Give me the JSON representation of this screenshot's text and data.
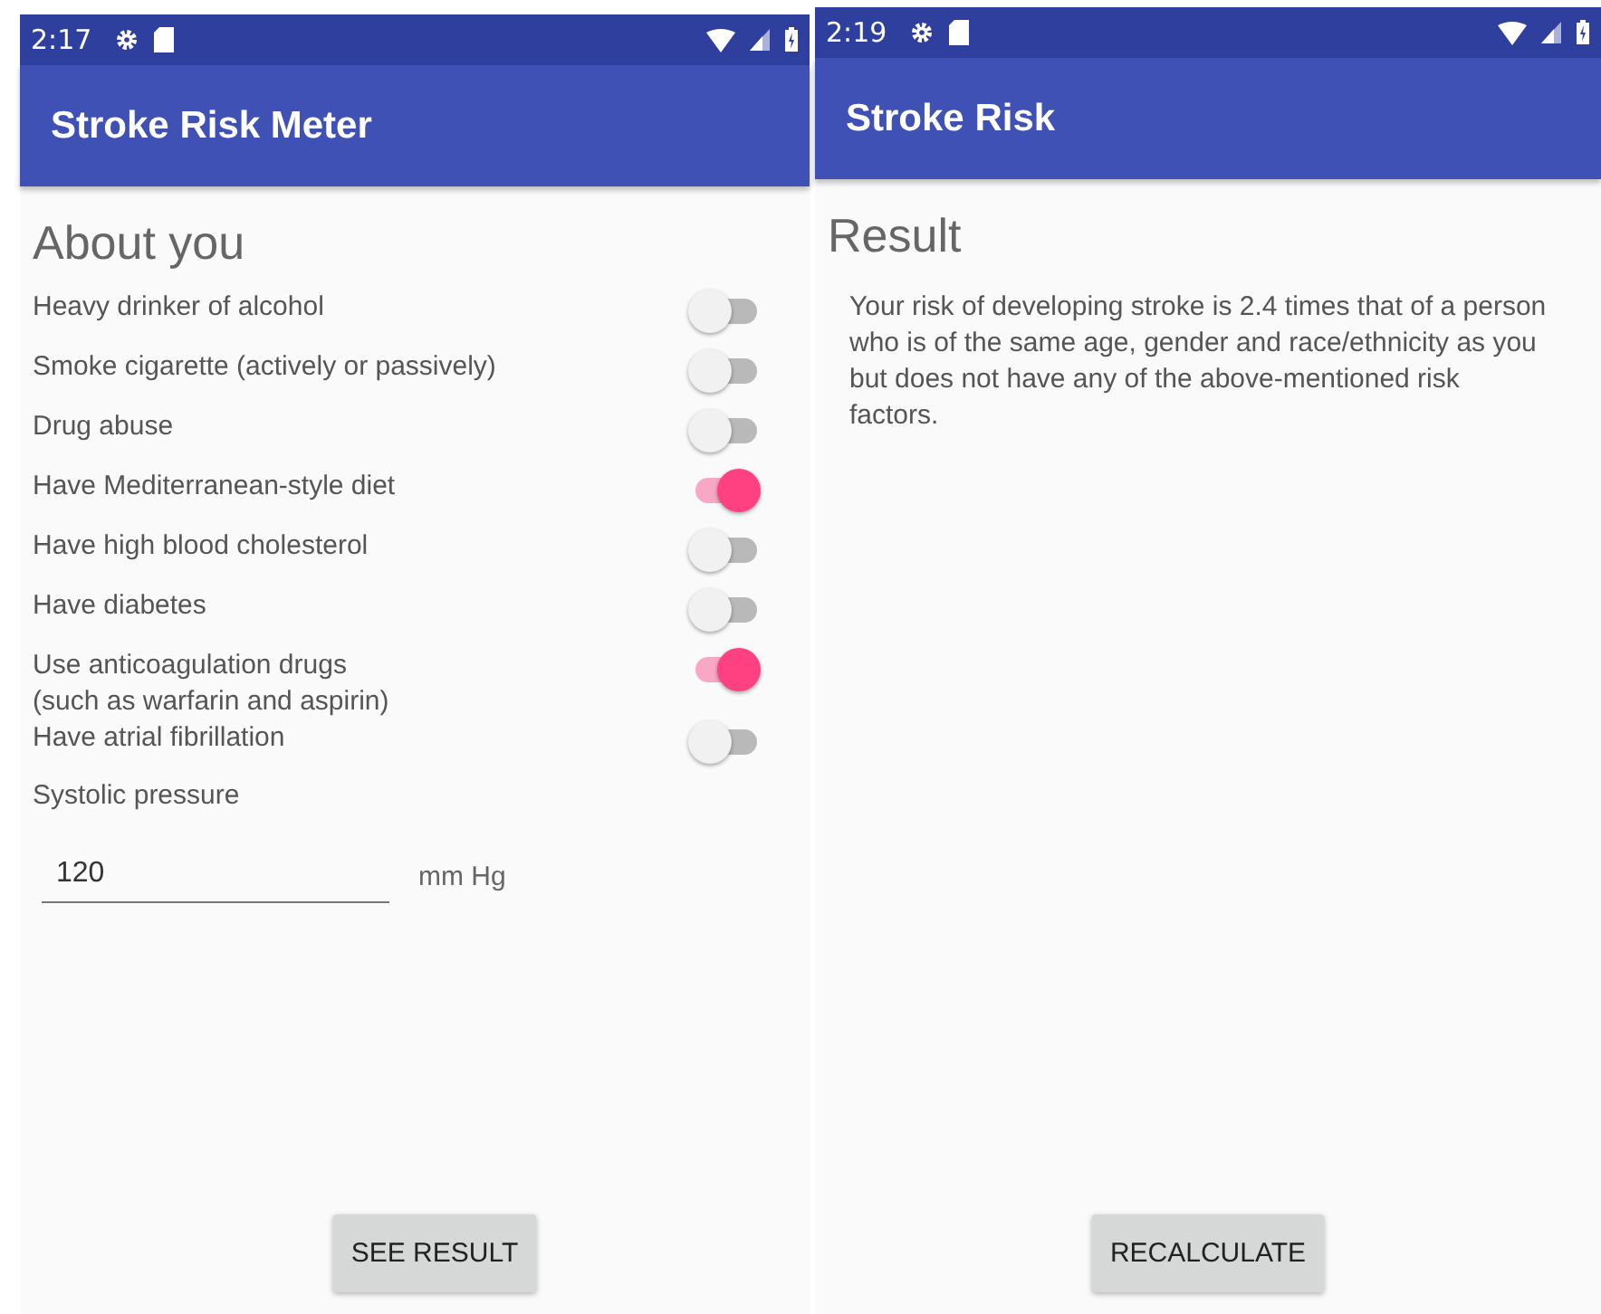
{
  "screens": [
    {
      "status_bar": {
        "time": "2:17"
      },
      "app_bar": {
        "title": "Stroke Risk Meter"
      },
      "heading": "About you",
      "toggles": [
        {
          "label": "Heavy drinker of alcohol",
          "on": false
        },
        {
          "label": "Smoke cigarette (actively or passively)",
          "on": false
        },
        {
          "label": "Drug abuse",
          "on": false
        },
        {
          "label": "Have Mediterranean-style diet",
          "on": true
        },
        {
          "label": "Have high blood cholesterol",
          "on": false
        },
        {
          "label": "Have diabetes",
          "on": false
        },
        {
          "label": "Use anticoagulation drugs\n (such as warfarin and aspirin)",
          "on": true
        },
        {
          "label": "Have atrial fibrillation",
          "on": false
        }
      ],
      "pressure": {
        "label": "Systolic pressure",
        "value": "120",
        "unit": "mm Hg"
      },
      "button": "SEE RESULT"
    },
    {
      "status_bar": {
        "time": "2:19"
      },
      "app_bar": {
        "title": "Stroke Risk"
      },
      "heading": "Result",
      "result_text": "Your risk of developing stroke is 2.4 times that of a person who is of the same age, gender and race/ethnicity as you but does not have any of the above-mentioned risk factors.",
      "button": "RECALCULATE"
    }
  ]
}
